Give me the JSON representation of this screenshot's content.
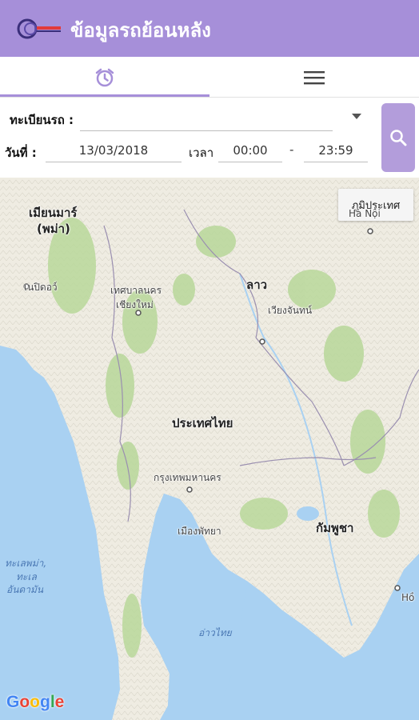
{
  "app": {
    "title": "ข้อมูลรถย้อนหลัง",
    "accent": "#a68fd9"
  },
  "tabs": [
    {
      "name": "history",
      "icon": "alarm-clock-icon",
      "selected": true
    },
    {
      "name": "menu",
      "icon": "hamburger-menu-icon",
      "selected": false
    }
  ],
  "form": {
    "plate_label": "ทะเบียนรถ :",
    "plate_value": "",
    "date_label": "วันที่ :",
    "date_value": "13/03/2018",
    "time_label": "เวลา",
    "start_time": "00:00",
    "separator": "-",
    "end_time": "23:59",
    "search_icon": "search-icon"
  },
  "map": {
    "terrain_button": "ภูมิประเทศ",
    "attribution": "Google",
    "labels": {
      "myanmar": "เมียนมาร์",
      "myanmar_sub": "(พม่า)",
      "naypyidaw": "เนปิดอว์",
      "chiangmai_1": "เทศบาลนคร",
      "chiangmai_2": "เชียงใหม่",
      "laos": "ลาว",
      "vientiane": "เวียงจันทน์",
      "thailand": "ประเทศไทย",
      "bangkok": "กรุงเทพมหานคร",
      "pattaya": "เมืองพัทยา",
      "cambodia": "กัมพูชา",
      "hanoi": "Hà Nội",
      "andaman_1": "ทะเลพม่า,",
      "andaman_2": "ทะเล",
      "andaman_3": "อันดามัน",
      "gulf": "อ่าวไทย",
      "hcm": "Hồ"
    }
  }
}
